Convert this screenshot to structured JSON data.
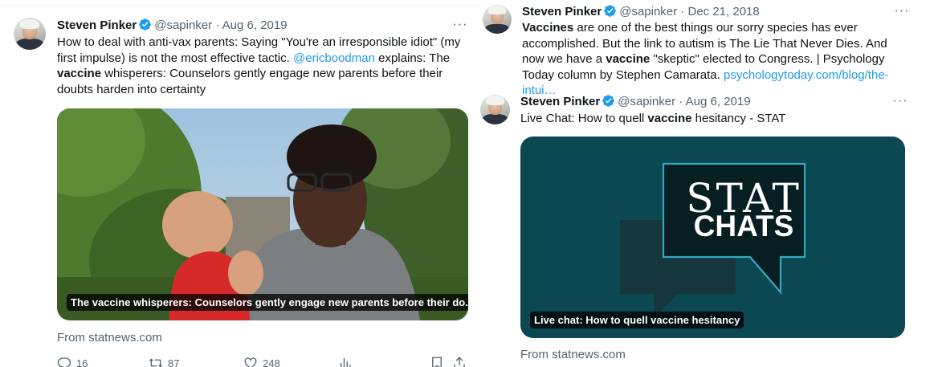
{
  "tweets": [
    {
      "name": "Steven Pinker",
      "handle": "@sapinker",
      "separator": "·",
      "date": "Aug 6, 2019",
      "more": "···",
      "text_parts": [
        {
          "t": "How to deal with anti-vax parents: Saying \"You're an irresponsible idiot\" (my first impulse) is not the most effective tactic. "
        },
        {
          "t": "@ericboodman",
          "mention": true
        },
        {
          "t": " explains: The "
        },
        {
          "t": "vaccine",
          "bold": true
        },
        {
          "t": " whisperers: Counselors gently engage new parents before their doubts harden into certainty"
        }
      ],
      "card_caption": "The vaccine whisperers: Counselors gently engage new parents before their do...",
      "source": "From statnews.com",
      "stats": {
        "replies": "16",
        "retweets": "87",
        "likes": "248"
      }
    },
    {
      "name": "Steven Pinker",
      "handle": "@sapinker",
      "separator": "·",
      "date": "Dec 21, 2018",
      "more": "···",
      "text_parts": [
        {
          "t": "Vaccines",
          "bold": true
        },
        {
          "t": " are one of the best things our sorry species has ever accomplished. But the link to autism is The Lie That Never Dies. And now we have a "
        },
        {
          "t": "vaccine",
          "bold": true
        },
        {
          "t": " \"skeptic\" elected to Congress. | Psychology Today column by Stephen Camarata. "
        },
        {
          "t": "psychologytoday.com/blog/the-intui…",
          "link": true
        }
      ]
    },
    {
      "name": "Steven Pinker",
      "handle": "@sapinker",
      "separator": "·",
      "date": "Aug 6, 2019",
      "more": "···",
      "text_parts": [
        {
          "t": "Live Chat: How to quell "
        },
        {
          "t": "vaccine",
          "bold": true
        },
        {
          "t": " hesitancy - STAT"
        }
      ],
      "card_title_line1": "STAT",
      "card_title_line2": "CHATS",
      "card_caption": "Live chat: How to quell vaccine hesitancy",
      "source": "From statnews.com"
    }
  ],
  "colors": {
    "verified": "#1d9bf0",
    "link": "#1d9bf0",
    "stat_card": "#0c4852"
  },
  "icons": {
    "verified": "verified-badge-icon",
    "reply": "reply-icon",
    "retweet": "retweet-icon",
    "like": "heart-icon",
    "views": "analytics-icon",
    "bookmark": "bookmark-icon",
    "share": "share-icon"
  }
}
